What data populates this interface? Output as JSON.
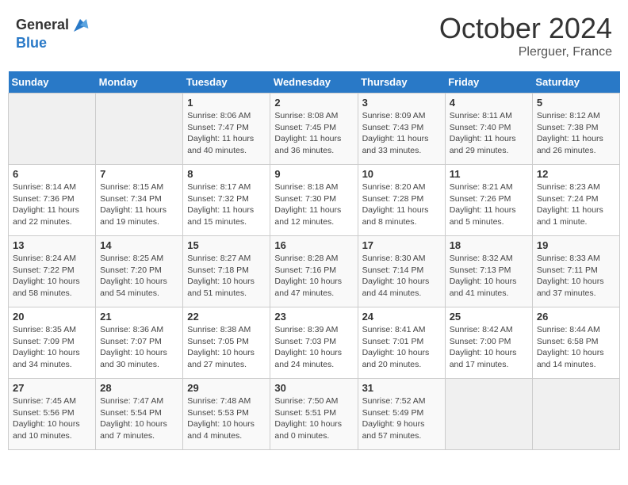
{
  "header": {
    "logo_line1": "General",
    "logo_line2": "Blue",
    "month": "October 2024",
    "location": "Plerguer, France"
  },
  "days_of_week": [
    "Sunday",
    "Monday",
    "Tuesday",
    "Wednesday",
    "Thursday",
    "Friday",
    "Saturday"
  ],
  "weeks": [
    [
      {
        "day": "",
        "info": ""
      },
      {
        "day": "",
        "info": ""
      },
      {
        "day": "1",
        "info": "Sunrise: 8:06 AM\nSunset: 7:47 PM\nDaylight: 11 hours and 40 minutes."
      },
      {
        "day": "2",
        "info": "Sunrise: 8:08 AM\nSunset: 7:45 PM\nDaylight: 11 hours and 36 minutes."
      },
      {
        "day": "3",
        "info": "Sunrise: 8:09 AM\nSunset: 7:43 PM\nDaylight: 11 hours and 33 minutes."
      },
      {
        "day": "4",
        "info": "Sunrise: 8:11 AM\nSunset: 7:40 PM\nDaylight: 11 hours and 29 minutes."
      },
      {
        "day": "5",
        "info": "Sunrise: 8:12 AM\nSunset: 7:38 PM\nDaylight: 11 hours and 26 minutes."
      }
    ],
    [
      {
        "day": "6",
        "info": "Sunrise: 8:14 AM\nSunset: 7:36 PM\nDaylight: 11 hours and 22 minutes."
      },
      {
        "day": "7",
        "info": "Sunrise: 8:15 AM\nSunset: 7:34 PM\nDaylight: 11 hours and 19 minutes."
      },
      {
        "day": "8",
        "info": "Sunrise: 8:17 AM\nSunset: 7:32 PM\nDaylight: 11 hours and 15 minutes."
      },
      {
        "day": "9",
        "info": "Sunrise: 8:18 AM\nSunset: 7:30 PM\nDaylight: 11 hours and 12 minutes."
      },
      {
        "day": "10",
        "info": "Sunrise: 8:20 AM\nSunset: 7:28 PM\nDaylight: 11 hours and 8 minutes."
      },
      {
        "day": "11",
        "info": "Sunrise: 8:21 AM\nSunset: 7:26 PM\nDaylight: 11 hours and 5 minutes."
      },
      {
        "day": "12",
        "info": "Sunrise: 8:23 AM\nSunset: 7:24 PM\nDaylight: 11 hours and 1 minute."
      }
    ],
    [
      {
        "day": "13",
        "info": "Sunrise: 8:24 AM\nSunset: 7:22 PM\nDaylight: 10 hours and 58 minutes."
      },
      {
        "day": "14",
        "info": "Sunrise: 8:25 AM\nSunset: 7:20 PM\nDaylight: 10 hours and 54 minutes."
      },
      {
        "day": "15",
        "info": "Sunrise: 8:27 AM\nSunset: 7:18 PM\nDaylight: 10 hours and 51 minutes."
      },
      {
        "day": "16",
        "info": "Sunrise: 8:28 AM\nSunset: 7:16 PM\nDaylight: 10 hours and 47 minutes."
      },
      {
        "day": "17",
        "info": "Sunrise: 8:30 AM\nSunset: 7:14 PM\nDaylight: 10 hours and 44 minutes."
      },
      {
        "day": "18",
        "info": "Sunrise: 8:32 AM\nSunset: 7:13 PM\nDaylight: 10 hours and 41 minutes."
      },
      {
        "day": "19",
        "info": "Sunrise: 8:33 AM\nSunset: 7:11 PM\nDaylight: 10 hours and 37 minutes."
      }
    ],
    [
      {
        "day": "20",
        "info": "Sunrise: 8:35 AM\nSunset: 7:09 PM\nDaylight: 10 hours and 34 minutes."
      },
      {
        "day": "21",
        "info": "Sunrise: 8:36 AM\nSunset: 7:07 PM\nDaylight: 10 hours and 30 minutes."
      },
      {
        "day": "22",
        "info": "Sunrise: 8:38 AM\nSunset: 7:05 PM\nDaylight: 10 hours and 27 minutes."
      },
      {
        "day": "23",
        "info": "Sunrise: 8:39 AM\nSunset: 7:03 PM\nDaylight: 10 hours and 24 minutes."
      },
      {
        "day": "24",
        "info": "Sunrise: 8:41 AM\nSunset: 7:01 PM\nDaylight: 10 hours and 20 minutes."
      },
      {
        "day": "25",
        "info": "Sunrise: 8:42 AM\nSunset: 7:00 PM\nDaylight: 10 hours and 17 minutes."
      },
      {
        "day": "26",
        "info": "Sunrise: 8:44 AM\nSunset: 6:58 PM\nDaylight: 10 hours and 14 minutes."
      }
    ],
    [
      {
        "day": "27",
        "info": "Sunrise: 7:45 AM\nSunset: 5:56 PM\nDaylight: 10 hours and 10 minutes."
      },
      {
        "day": "28",
        "info": "Sunrise: 7:47 AM\nSunset: 5:54 PM\nDaylight: 10 hours and 7 minutes."
      },
      {
        "day": "29",
        "info": "Sunrise: 7:48 AM\nSunset: 5:53 PM\nDaylight: 10 hours and 4 minutes."
      },
      {
        "day": "30",
        "info": "Sunrise: 7:50 AM\nSunset: 5:51 PM\nDaylight: 10 hours and 0 minutes."
      },
      {
        "day": "31",
        "info": "Sunrise: 7:52 AM\nSunset: 5:49 PM\nDaylight: 9 hours and 57 minutes."
      },
      {
        "day": "",
        "info": ""
      },
      {
        "day": "",
        "info": ""
      }
    ]
  ]
}
